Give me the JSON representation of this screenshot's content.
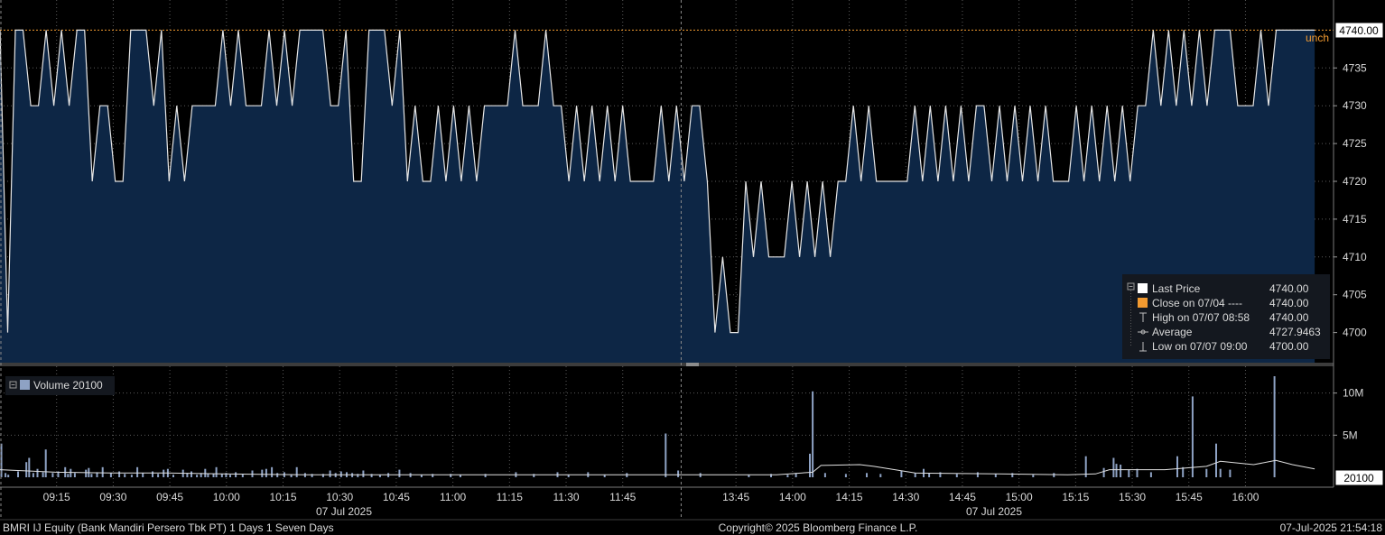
{
  "chart_data": {
    "type": "line",
    "price_panel": {
      "ylim": [
        4695,
        4745
      ],
      "y_ticks": [
        "4700",
        "4705",
        "4710",
        "4715",
        "4720",
        "4725",
        "4730",
        "4735"
      ],
      "last_price_tag": "4740.00",
      "reference_label": "unch",
      "reference_value": 4740,
      "series": {
        "name": "Last Price",
        "values": [
          4740,
          4700,
          4740,
          4740,
          4730,
          4730,
          4740,
          4730,
          4740,
          4730,
          4740,
          4740,
          4720,
          4730,
          4730,
          4720,
          4720,
          4740,
          4740,
          4740,
          4730,
          4740,
          4720,
          4730,
          4720,
          4730,
          4730,
          4730,
          4730,
          4740,
          4730,
          4740,
          4730,
          4730,
          4730,
          4740,
          4730,
          4740,
          4730,
          4740,
          4740,
          4740,
          4740,
          4730,
          4730,
          4740,
          4720,
          4720,
          4740,
          4740,
          4740,
          4730,
          4740,
          4720,
          4730,
          4720,
          4720,
          4730,
          4720,
          4730,
          4720,
          4730,
          4720,
          4730,
          4730,
          4730,
          4730,
          4740,
          4730,
          4730,
          4730,
          4740,
          4730,
          4730,
          4720,
          4730,
          4720,
          4730,
          4720,
          4730,
          4720,
          4730,
          4720,
          4720,
          4720,
          4720,
          4730,
          4720,
          4730,
          4720,
          4730,
          4730,
          4720,
          4700,
          4710,
          4700,
          4700,
          4720,
          4710,
          4720,
          4710,
          4710,
          4710,
          4720,
          4710,
          4720,
          4710,
          4720,
          4710,
          4720,
          4720,
          4730,
          4720,
          4730,
          4720,
          4720,
          4720,
          4720,
          4720,
          4730,
          4720,
          4730,
          4720,
          4730,
          4720,
          4730,
          4720,
          4730,
          4730,
          4720,
          4730,
          4720,
          4730,
          4720,
          4730,
          4720,
          4730,
          4720,
          4720,
          4720,
          4730,
          4720,
          4730,
          4720,
          4730,
          4720,
          4730,
          4720,
          4730,
          4730,
          4740,
          4730,
          4740,
          4730,
          4740,
          4730,
          4740,
          4730,
          4740,
          4740,
          4740,
          4730,
          4730,
          4730,
          4740,
          4730,
          4740,
          4740,
          4740,
          4740,
          4740,
          4740
        ]
      }
    },
    "volume_panel": {
      "ylim": [
        0,
        12
      ],
      "y_ticks": [
        "5M",
        "10M"
      ],
      "last_volume_tag": "20100",
      "legend": "Volume 20100",
      "spikes": [
        [
          1,
          4
        ],
        [
          4,
          0.5
        ],
        [
          6,
          0.3
        ],
        [
          13,
          0.7
        ],
        [
          19,
          1.8
        ],
        [
          21,
          2.3
        ],
        [
          24,
          0.5
        ],
        [
          27,
          1
        ],
        [
          31,
          0.6
        ],
        [
          33,
          3.3
        ],
        [
          38,
          0.5
        ],
        [
          42,
          0.7
        ],
        [
          47,
          1.2
        ],
        [
          49,
          0.4
        ],
        [
          51,
          1
        ],
        [
          54,
          0.5
        ],
        [
          62,
          0.9
        ],
        [
          64,
          1.1
        ],
        [
          66,
          0.4
        ],
        [
          70,
          0.6
        ],
        [
          74,
          1.2
        ],
        [
          80,
          0.5
        ],
        [
          86,
          0.7
        ],
        [
          90,
          0.4
        ],
        [
          95,
          0.3
        ],
        [
          99,
          1.2
        ],
        [
          103,
          0.5
        ],
        [
          110,
          0.7
        ],
        [
          114,
          0.4
        ],
        [
          118,
          0.9
        ],
        [
          121,
          1
        ],
        [
          125,
          0.3
        ],
        [
          132,
          0.9
        ],
        [
          135,
          0.5
        ],
        [
          138,
          0.7
        ],
        [
          142,
          0.3
        ],
        [
          145,
          0.5
        ],
        [
          148,
          1
        ],
        [
          150,
          0.4
        ],
        [
          154,
          0.4
        ],
        [
          156,
          1.2
        ],
        [
          160,
          0.4
        ],
        [
          163,
          0.5
        ],
        [
          166,
          0.3
        ],
        [
          170,
          0.6
        ],
        [
          175,
          0.4
        ],
        [
          182,
          0.8
        ],
        [
          189,
          0.9
        ],
        [
          192,
          1
        ],
        [
          196,
          1.2
        ],
        [
          200,
          0.5
        ],
        [
          205,
          0.6
        ],
        [
          210,
          0.3
        ],
        [
          214,
          1.2
        ],
        [
          220,
          0.5
        ],
        [
          225,
          0.4
        ],
        [
          233,
          0.4
        ],
        [
          238,
          0.8
        ],
        [
          242,
          0.5
        ],
        [
          246,
          0.7
        ],
        [
          250,
          0.6
        ],
        [
          254,
          0.5
        ],
        [
          258,
          0.4
        ],
        [
          262,
          0.8
        ],
        [
          268,
          0.4
        ],
        [
          274,
          0.3
        ],
        [
          280,
          0.5
        ],
        [
          288,
          0.9
        ],
        [
          296,
          0.5
        ],
        [
          304,
          0.3
        ],
        [
          312,
          0.4
        ],
        [
          325,
          0.4
        ],
        [
          332,
          0.3
        ],
        [
          350,
          0.4
        ],
        [
          372,
          0.6
        ],
        [
          385,
          0.4
        ],
        [
          402,
          0.6
        ],
        [
          410,
          0.3
        ],
        [
          424,
          0.6
        ],
        [
          436,
          0.3
        ],
        [
          452,
          0.5
        ],
        [
          480,
          5.2
        ],
        [
          489,
          0.8
        ],
        [
          505,
          0.5
        ],
        [
          540,
          0.3
        ],
        [
          556,
          0.4
        ],
        [
          568,
          0.3
        ],
        [
          574,
          0.5
        ],
        [
          584,
          2.8
        ],
        [
          586,
          10.2
        ],
        [
          595,
          0.5
        ],
        [
          610,
          0.4
        ],
        [
          625,
          0.5
        ],
        [
          635,
          0.4
        ],
        [
          650,
          0.8
        ],
        [
          660,
          0.5
        ],
        [
          666,
          1
        ],
        [
          670,
          0.5
        ],
        [
          678,
          0.6
        ],
        [
          690,
          0.4
        ],
        [
          705,
          0.6
        ],
        [
          718,
          0.4
        ],
        [
          730,
          0.5
        ],
        [
          745,
          0.3
        ],
        [
          760,
          0.5
        ],
        [
          783,
          2.5
        ],
        [
          796,
          1.1
        ],
        [
          803,
          2.3
        ],
        [
          805,
          1.6
        ],
        [
          808,
          1.5
        ],
        [
          814,
          0.9
        ],
        [
          820,
          1
        ],
        [
          830,
          0.6
        ],
        [
          849,
          2.5
        ],
        [
          853,
          1.2
        ],
        [
          860,
          9.6
        ],
        [
          870,
          1
        ],
        [
          877,
          4
        ],
        [
          880,
          1
        ],
        [
          887,
          0.9
        ],
        [
          919,
          12
        ]
      ],
      "average": [
        [
          0,
          0.9
        ],
        [
          40,
          0.6
        ],
        [
          80,
          0.5
        ],
        [
          120,
          0.5
        ],
        [
          160,
          0.4
        ],
        [
          220,
          0.3
        ],
        [
          300,
          0.3
        ],
        [
          380,
          0.3
        ],
        [
          470,
          0.3
        ],
        [
          560,
          0.3
        ],
        [
          586,
          0.6
        ],
        [
          592,
          1.4
        ],
        [
          620,
          1.5
        ],
        [
          630,
          1.3
        ],
        [
          660,
          0.5
        ],
        [
          720,
          0.4
        ],
        [
          770,
          0.3
        ],
        [
          790,
          0.4
        ],
        [
          800,
          0.9
        ],
        [
          840,
          0.9
        ],
        [
          870,
          1.3
        ],
        [
          880,
          1.9
        ],
        [
          904,
          1.5
        ],
        [
          920,
          2
        ],
        [
          932,
          1.5
        ],
        [
          948,
          1
        ]
      ]
    },
    "x_axis": {
      "ticks": [
        {
          "t": 45,
          "label": "09:15"
        },
        {
          "t": 90,
          "label": "09:30"
        },
        {
          "t": 135,
          "label": "09:45"
        },
        {
          "t": 180,
          "label": "10:00"
        },
        {
          "t": 225,
          "label": "10:15"
        },
        {
          "t": 270,
          "label": "10:30"
        },
        {
          "t": 315,
          "label": "10:45"
        },
        {
          "t": 360,
          "label": "11:00"
        },
        {
          "t": 405,
          "label": "11:15"
        },
        {
          "t": 450,
          "label": "11:30"
        },
        {
          "t": 495,
          "label": "11:45"
        },
        {
          "t": 585,
          "label": "13:45"
        },
        {
          "t": 630,
          "label": "14:00"
        },
        {
          "t": 675,
          "label": "14:15"
        },
        {
          "t": 720,
          "label": "14:30"
        },
        {
          "t": 765,
          "label": "14:45"
        },
        {
          "t": 810,
          "label": "15:00"
        },
        {
          "t": 855,
          "label": "15:15"
        },
        {
          "t": 900,
          "label": "15:30"
        },
        {
          "t": 945,
          "label": "15:45"
        },
        {
          "t": 990,
          "label": "16:00"
        }
      ],
      "session_break": 540,
      "range": [
        0,
        1060
      ],
      "date_labels": [
        "07 Jul 2025",
        "07 Jul 2025"
      ]
    },
    "legend": [
      {
        "marker": "white-square-icon",
        "label": "Last Price",
        "value": "4740.00"
      },
      {
        "marker": "orange-square-icon",
        "label": "Close on 07/04 ----",
        "value": "4740.00"
      },
      {
        "marker": "high-marker-icon",
        "label": "High on 07/07 08:58",
        "value": "4740.00"
      },
      {
        "marker": "average-marker-icon",
        "label": "Average",
        "value": "4727.9463"
      },
      {
        "marker": "low-marker-icon",
        "label": "Low on 07/07 09:00",
        "value": "4700.00"
      }
    ],
    "colors": {
      "background": "#000000",
      "area_fill": "#0d2645",
      "price_line": "#e6e6e6",
      "reference_line": "#f29a30",
      "grid": "#5a5a5a",
      "volume_bar": "#8ea2c4",
      "tag_bg": "#ffffff",
      "legend_bg": "#14181f"
    }
  },
  "footer": {
    "security": "BMRI IJ Equity (Bank Mandiri Persero Tbk PT) 1 Days 1 Seven Days",
    "copyright": "Copyright© 2025 Bloomberg Finance L.P.",
    "timestamp": "07-Jul-2025 21:54:18"
  }
}
